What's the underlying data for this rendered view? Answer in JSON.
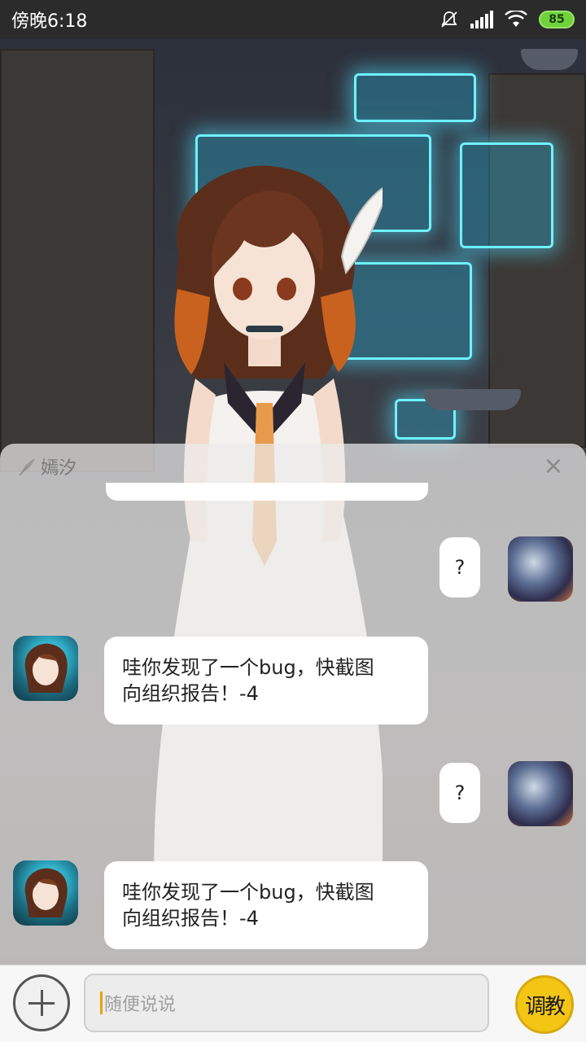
{
  "status_bar": {
    "time": "傍晚6:18",
    "battery": "85",
    "icons": [
      "bell-muted-icon",
      "signal-icon",
      "wifi-icon",
      "battery-icon"
    ]
  },
  "chat": {
    "title": "嫣汐",
    "close": "×",
    "messages": [
      {
        "from": "user",
        "text": "?"
      },
      {
        "from": "bot",
        "text": "哇你发现了一个bug，快截图\n向组织报告！-4"
      },
      {
        "from": "user",
        "text": "?"
      },
      {
        "from": "bot",
        "text": "哇你发现了一个bug，快截图\n向组织报告！-4"
      }
    ]
  },
  "input": {
    "placeholder": "随便说说",
    "teach_label": "调教"
  },
  "colors": {
    "accent": "#f3c616",
    "screen_glow": "#6ff2ff",
    "battery": "#6fd23b"
  }
}
